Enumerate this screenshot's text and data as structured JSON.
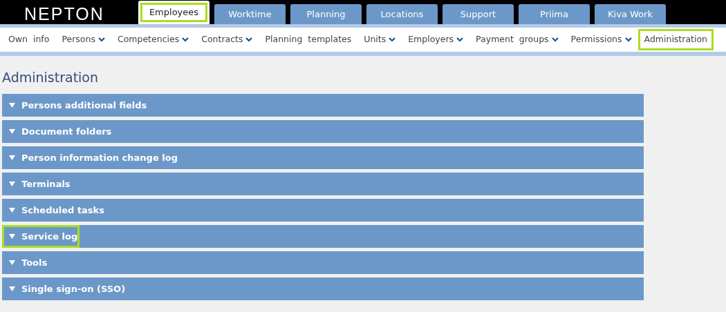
{
  "logo": "NEPTON",
  "tabs": [
    {
      "label": "Employees",
      "selected": true,
      "highlighted": true
    },
    {
      "label": "Worktime",
      "selected": false,
      "highlighted": false
    },
    {
      "label": "Planning",
      "selected": false,
      "highlighted": false
    },
    {
      "label": "Locations",
      "selected": false,
      "highlighted": false
    },
    {
      "label": "Support",
      "selected": false,
      "highlighted": false
    },
    {
      "label": "Priima",
      "selected": false,
      "highlighted": false
    },
    {
      "label": "Kiva Work",
      "selected": false,
      "highlighted": false
    }
  ],
  "subnav": [
    {
      "label": "Own info",
      "dropdown": false,
      "highlighted": false
    },
    {
      "label": "Persons",
      "dropdown": true,
      "highlighted": false
    },
    {
      "label": "Competencies",
      "dropdown": true,
      "highlighted": false
    },
    {
      "label": "Contracts",
      "dropdown": true,
      "highlighted": false
    },
    {
      "label": "Planning templates",
      "dropdown": false,
      "highlighted": false
    },
    {
      "label": "Units",
      "dropdown": true,
      "highlighted": false
    },
    {
      "label": "Employers",
      "dropdown": true,
      "highlighted": false
    },
    {
      "label": "Payment groups",
      "dropdown": true,
      "highlighted": false
    },
    {
      "label": "Permissions",
      "dropdown": true,
      "highlighted": false
    },
    {
      "label": "Administration",
      "dropdown": false,
      "highlighted": true
    }
  ],
  "heading": "Administration",
  "panels": [
    {
      "title": "Persons additional fields",
      "expanded": false,
      "highlighted": false
    },
    {
      "title": "Document folders",
      "expanded": false,
      "highlighted": false
    },
    {
      "title": "Person information change log",
      "expanded": false,
      "highlighted": false
    },
    {
      "title": "Terminals",
      "expanded": false,
      "highlighted": false
    },
    {
      "title": "Scheduled tasks",
      "expanded": false,
      "highlighted": false
    },
    {
      "title": "Service log",
      "expanded": false,
      "highlighted": true
    },
    {
      "title": "Tools",
      "expanded": false,
      "highlighted": false
    },
    {
      "title": "Single sign-on (SSO)",
      "expanded": false,
      "highlighted": false
    }
  ]
}
